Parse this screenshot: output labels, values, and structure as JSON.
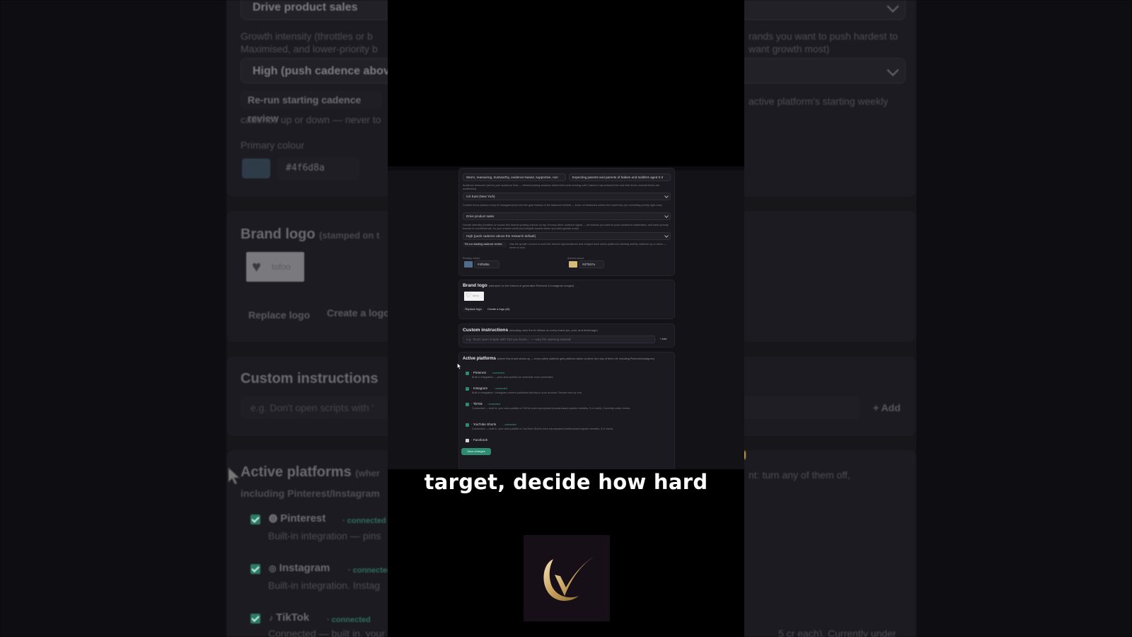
{
  "background": {
    "goal_select": "Drive product sales",
    "growth_help": "Growth intensity (throttles or boosts this brand's posting volume on top of every other cadence signal — set brands you want to push hardest to Maximised, and lower-priority brands to Low/Moderate, so your shared credit pool weights toward where you want growth most)",
    "growth_help_left_1": "Growth intensity (throttles or b",
    "growth_help_left_2": "Maximised, and lower-priority b",
    "growth_help_right_1": "rands you want to push hardest to",
    "growth_help_right_2": "want growth most)",
    "intensity_select": "High (push cadence above t",
    "rerun_button": "Re-run starting cadence review",
    "rerun_help_right": "active platform's starting weekly",
    "rerun_help_left": "cadence up or down — never to",
    "primary_colour_label": "Primary colour",
    "primary_colour_value": "#4f6d8a",
    "brand_logo_title": "Brand logo",
    "brand_logo_note": "(stamped on t",
    "logo_text": "tofoo",
    "replace_logo": "Replace logo",
    "create_logo": "Create a logo",
    "custom_instructions_title": "Custom instructions",
    "custom_instructions_placeholder": "e.g. Don't open scripts with '",
    "add_button": "+ Add",
    "active_platforms_title": "Active platforms",
    "active_platforms_note": "(wher",
    "active_platforms_note_right": "nt: turn any of them off,",
    "active_platforms_note_2": "including Pinterest/Instagram",
    "platforms": [
      {
        "name": "Pinterest",
        "status": "connected",
        "desc": "Built-in integration — pins"
      },
      {
        "name": "Instagram",
        "status": "connected",
        "desc": "Built-in integration. Instag"
      },
      {
        "name": "TikTok",
        "status": "connected",
        "desc": "Connected — built in, your"
      }
    ],
    "tiktok_right_note": "5 cr each). Currently under"
  },
  "screenshot": {
    "tone_value": "Warm, reassuring, trustworthy, evidence-based, supportive, non",
    "audience_value": "Expecting parents and parents of babies and toddlers aged 0-3",
    "timezone_help": "Audience timezone (where your audience lives — default posting windows follow their local evening until Cadence has learned their real best times; learned times are unaffected)",
    "timezone_value": "US East (New York)",
    "focus_help": "Content focus (biases every AI Instagram/post into this goal instead of the balanced default — leave on Balanced unless the brand has one overriding priority right now)",
    "focus_value": "Drive product sales",
    "growth_help": "Growth intensity (throttles or boosts this brand's posting volume on top of every other cadence signal — set brands you want to push hardest to Maximised, and lower-priority brands to Low/Moderate, so your shared credit pool weights toward where you want growth most)",
    "intensity_value": "High (push cadence above the research default)",
    "rerun_button": "Re-run starting cadence review",
    "rerun_help": "Has the growth council re-read this brand's type/audience and nudged each active platform's starting weekly cadence up or down — never to zero.",
    "primary_label": "Primary colour",
    "primary_value": "#4f6d8a",
    "accent_label": "Accent colour",
    "accent_value": "#d7b97a",
    "brand_logo_title": "Brand logo",
    "brand_logo_note": "(stamped on the bottom of generated Pinterest & Instagram images)",
    "replace_logo": "Replace logo",
    "create_logo": "Create a logo (AI)",
    "custom_title": "Custom instructions",
    "custom_note": "(standing rules the AI follows on every brand pin, post, and text/image)",
    "custom_placeholder": "e.g. 'Don't open scripts with 'Did you know...' — vary the opening instead'",
    "add_button": "+ Add",
    "platforms_title": "Active platforms",
    "platforms_note": "(where this brand shows up — every active platform gets platform-native content; turn any of them off, including Pinterest/Instagram)",
    "platforms": [
      {
        "name": "Pinterest",
        "status": "connected",
        "desc": "Built-in integration — pins auto-publish on schedule once connected.",
        "checked": true
      },
      {
        "name": "Instagram",
        "status": "connected",
        "desc": "Built-in integration. Instagram content published directly to your account. Review one by one.",
        "checked": true
      },
      {
        "name": "TikTok",
        "status": "connected",
        "desc": "Connected — built in, your auto-publish to TikTok once repurposed (media-based caption rewrites, 5 cr each). Currently under review.",
        "checked": true
      },
      {
        "name": "YouTube Shorts",
        "status": "connected",
        "desc": "Connected — built in, your auto-publish to YouTube Shorts once repurposed (media-based caption rewrites, 5 cr each).",
        "checked": true
      },
      {
        "name": "Facebook",
        "status": "",
        "desc": "",
        "checked": false
      }
    ],
    "save_button": "Save changes"
  },
  "caption": "target, decide how hard",
  "colors": {
    "primary": "#4f6d8a",
    "accent": "#d7b97a",
    "connected_green": "#3fa785",
    "save_green": "#2e8a70"
  },
  "icons": [
    "chevron-down-icon",
    "checkbox-icon",
    "pinterest-icon",
    "instagram-icon",
    "tiktok-icon",
    "youtube-icon",
    "facebook-icon",
    "mouse-cursor-icon",
    "checkmark-logo-icon"
  ]
}
